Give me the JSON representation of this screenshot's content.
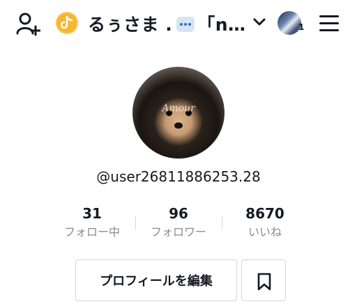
{
  "header": {
    "title": "るぅさま . 「n…",
    "title_parts": {
      "before": "るぅさま .",
      "after": "「n…"
    },
    "chat_emoji": "speech-balloon-icon",
    "ig_badge": "1",
    "icons": [
      "add-friend-icon",
      "tiktok-coin-icon",
      "chevron-down-icon",
      "account-avatar",
      "menu-icon"
    ]
  },
  "profile": {
    "avatar": "pomeranian-photo",
    "avatar_watermark": "Amour",
    "username": "@user26811886253.28"
  },
  "stats": [
    {
      "value": "31",
      "label": "フォロー中"
    },
    {
      "value": "96",
      "label": "フォロワー"
    },
    {
      "value": "8670",
      "label": "いいね"
    }
  ],
  "actions": {
    "edit_profile": "プロフィールを編集",
    "bookmark_icon": "bookmark-icon"
  },
  "colors": {
    "text": "#161823",
    "secondary": "#8a8b91",
    "coin": "#f5b731",
    "border": "#d6d6d8"
  }
}
